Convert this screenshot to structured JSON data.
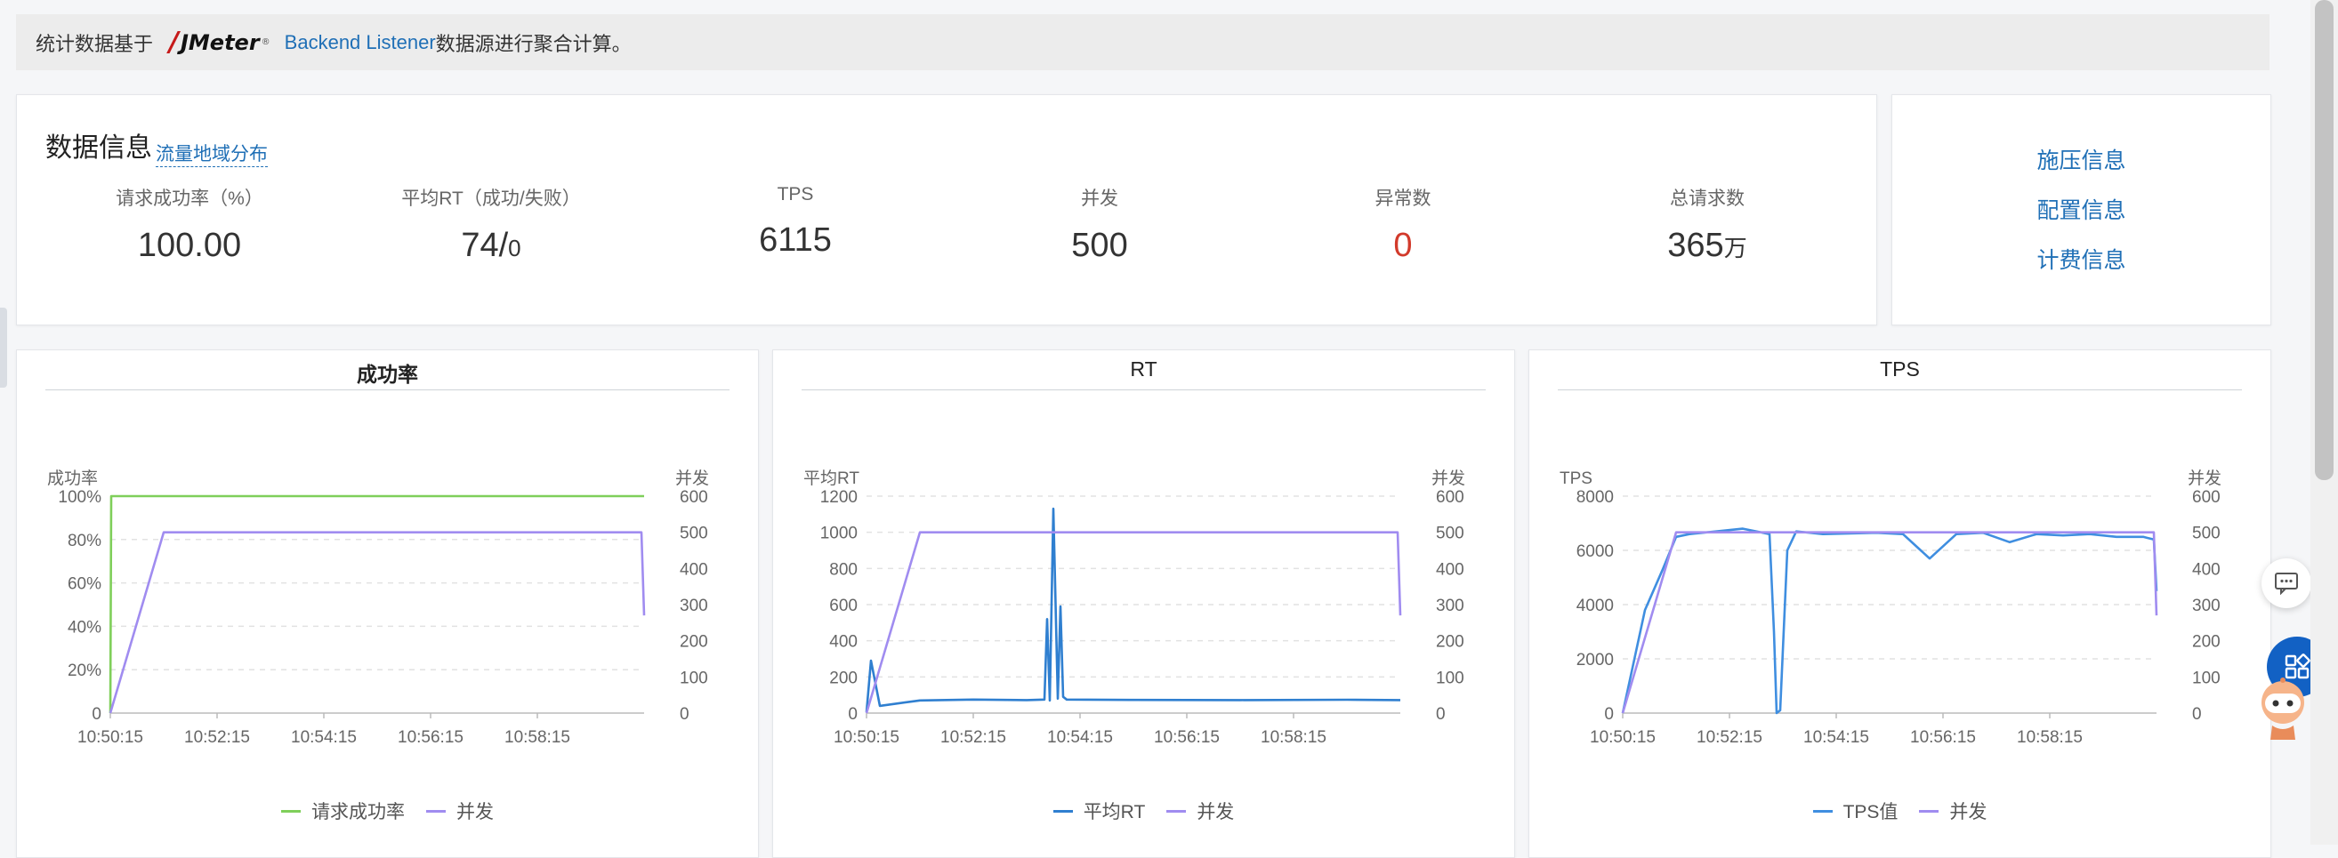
{
  "notice": {
    "prefix": "统计数据基于",
    "jmeter_logo": "JMeter",
    "jmeter_trademark": "®",
    "link": "Backend Listener",
    "suffix": "数据源进行聚合计算。"
  },
  "data_info": {
    "title": "数据信息",
    "geo_link": "流量地域分布",
    "metrics": [
      {
        "label": "请求成功率（%）",
        "value": "100.00",
        "unit": ""
      },
      {
        "label": "平均RT（成功/失败）",
        "value": "74/",
        "unit": "0"
      },
      {
        "label": "TPS",
        "value": "6115",
        "unit": ""
      },
      {
        "label": "并发",
        "value": "500",
        "unit": ""
      },
      {
        "label": "异常数",
        "value": "0",
        "unit": ""
      },
      {
        "label": "总请求数",
        "value": "365",
        "unit": "万"
      }
    ]
  },
  "side_links": {
    "pressure": "施压信息",
    "config": "配置信息",
    "billing": "计费信息"
  },
  "colors": {
    "success": "#7fcf5a",
    "concurrency": "#a08cf0",
    "rt": "#2f7fd0",
    "tps": "#3f8ee0",
    "error": "#d23a2b",
    "link": "#1f6fb6"
  },
  "chart_data": [
    {
      "type": "line",
      "title": "成功率",
      "ylabel": "成功率",
      "y2label": "并发",
      "x_ticks": [
        "10:50:15",
        "10:52:15",
        "10:54:15",
        "10:56:15",
        "10:58:15"
      ],
      "xlim": [
        "10:50:15",
        "11:00:15"
      ],
      "y_ticks": [
        "0",
        "20%",
        "40%",
        "60%",
        "80%",
        "100%"
      ],
      "ylim": [
        0,
        100
      ],
      "y2_ticks": [
        "0",
        "100",
        "200",
        "300",
        "400",
        "500",
        "600"
      ],
      "y2lim": [
        0,
        600
      ],
      "grid": true,
      "legend_position": "bottom",
      "series": [
        {
          "name": "请求成功率",
          "axis": "left",
          "color": "#7fcf5a",
          "x": [
            "10:50:15",
            "10:50:16",
            "11:00:15"
          ],
          "y": [
            0,
            100,
            100
          ]
        },
        {
          "name": "并发",
          "axis": "right",
          "color": "#a08cf0",
          "x": [
            "10:50:15",
            "10:51:15",
            "11:00:12",
            "11:00:15"
          ],
          "y": [
            0,
            500,
            500,
            270
          ]
        }
      ]
    },
    {
      "type": "line",
      "title": "RT",
      "ylabel": "平均RT",
      "y2label": "并发",
      "x_ticks": [
        "10:50:15",
        "10:52:15",
        "10:54:15",
        "10:56:15",
        "10:58:15"
      ],
      "xlim": [
        "10:50:15",
        "11:00:15"
      ],
      "y_ticks": [
        "0",
        "200",
        "400",
        "600",
        "800",
        "1000",
        "1200"
      ],
      "ylim": [
        0,
        1200
      ],
      "y2_ticks": [
        "0",
        "100",
        "200",
        "300",
        "400",
        "500",
        "600"
      ],
      "y2lim": [
        0,
        600
      ],
      "grid": true,
      "legend_position": "bottom",
      "series": [
        {
          "name": "平均RT",
          "axis": "left",
          "color": "#2f7fd0",
          "x": [
            "10:50:15",
            "10:50:20",
            "10:50:30",
            "10:51:15",
            "10:52:15",
            "10:53:15",
            "10:53:35",
            "10:53:38",
            "10:53:41",
            "10:53:45",
            "10:53:50",
            "10:53:53",
            "10:53:56",
            "10:54:00",
            "10:55:15",
            "10:57:15",
            "10:59:15",
            "11:00:15"
          ],
          "y": [
            5,
            290,
            40,
            70,
            75,
            72,
            75,
            520,
            70,
            1130,
            80,
            590,
            90,
            75,
            73,
            72,
            74,
            72
          ]
        },
        {
          "name": "并发",
          "axis": "right",
          "color": "#a08cf0",
          "x": [
            "10:50:15",
            "10:51:15",
            "11:00:12",
            "11:00:15"
          ],
          "y": [
            0,
            500,
            500,
            270
          ]
        }
      ]
    },
    {
      "type": "line",
      "title": "TPS",
      "ylabel": "TPS",
      "y2label": "并发",
      "x_ticks": [
        "10:50:15",
        "10:52:15",
        "10:54:15",
        "10:56:15",
        "10:58:15"
      ],
      "xlim": [
        "10:50:15",
        "11:00:15"
      ],
      "y_ticks": [
        "0",
        "2000",
        "4000",
        "6000",
        "8000"
      ],
      "ylim": [
        0,
        8000
      ],
      "y2_ticks": [
        "0",
        "100",
        "200",
        "300",
        "400",
        "500",
        "600"
      ],
      "y2lim": [
        0,
        600
      ],
      "grid": true,
      "legend_position": "bottom",
      "series": [
        {
          "name": "TPS值",
          "axis": "left",
          "color": "#3f8ee0",
          "x": [
            "10:50:15",
            "10:50:40",
            "10:51:00",
            "10:51:15",
            "10:51:30",
            "10:52:00",
            "10:52:30",
            "10:53:00",
            "10:53:05",
            "10:53:08",
            "10:53:12",
            "10:53:20",
            "10:53:30",
            "10:54:00",
            "10:55:00",
            "10:55:30",
            "10:56:00",
            "10:56:30",
            "10:57:00",
            "10:57:30",
            "10:58:00",
            "10:58:30",
            "10:59:00",
            "10:59:30",
            "11:00:00",
            "11:00:12",
            "11:00:15"
          ],
          "y": [
            0,
            3800,
            5300,
            6500,
            6600,
            6700,
            6800,
            6600,
            3000,
            0,
            100,
            6000,
            6700,
            6600,
            6650,
            6600,
            5700,
            6600,
            6650,
            6300,
            6600,
            6550,
            6600,
            6500,
            6500,
            6400,
            4500
          ]
        },
        {
          "name": "并发",
          "axis": "right",
          "color": "#a08cf0",
          "x": [
            "10:50:15",
            "10:51:15",
            "11:00:12",
            "11:00:15"
          ],
          "y": [
            0,
            500,
            500,
            270
          ]
        }
      ]
    }
  ]
}
